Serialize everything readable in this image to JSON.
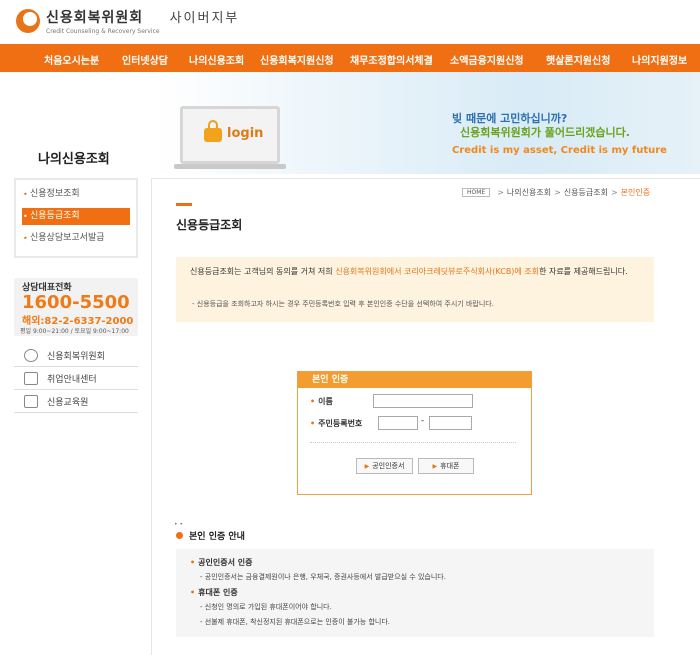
{
  "header": {
    "logo_title": "신용회복위원회",
    "logo_sub": "Credit Counseling & Recovery Service",
    "cyber": "사이버지부"
  },
  "gnb": [
    "처음오시는분",
    "인터넷상담",
    "나의신용조회",
    "신용회복지원신청",
    "채무조정합의서체결",
    "소액금융지원신청",
    "햇살론지원신청",
    "나의지원정보"
  ],
  "banner": {
    "page_heading": "나의신용조회",
    "login": "login",
    "slogan1": "빚 때문에 고민하십니까?",
    "slogan2": "신용회복위원회가 풀어드리겠습니다.",
    "slogan3": "Credit is my asset, Credit is my future"
  },
  "lnb": [
    "신용정보조회",
    "신용등급조회",
    "신용상담보고서발급"
  ],
  "phone": {
    "label": "상담대표전화",
    "number": "1600-5500",
    "abroad": "해외:82-2-6337-2000",
    "hours": "평일 9:00~21:00 / 토요일 9:00~17:00"
  },
  "quick_links": [
    "신용회복위원회",
    "취업안내센터",
    "신용교육원"
  ],
  "breadcrumb": {
    "home": "HOME",
    "level1": "나의신용조회",
    "level2": "신용등급조회",
    "current": "본인인증"
  },
  "title": "신용등급조회",
  "notice": {
    "p1": "신용등급조회는 고객님의 동의를 거쳐 저희 ",
    "p1_hl": "신용회복위원회에서 코리아크레딧뷰로주식회사(KCB)에 조회",
    "p1_end": "한 자료를 제공해드립니다.",
    "p2": "- 신용등급을 조회하고자 하시는 경우 주민등록번호 입력 후 본인인증 수단을 선택하여 주시기 바랍니다."
  },
  "auth": {
    "head": "본인 인증",
    "name_label": "이름",
    "rrn_label": "주민등록번호",
    "dash": "-",
    "btn_cert": "공인인증서",
    "btn_phone": "휴대폰"
  },
  "guide": {
    "dots": "• •",
    "title": "본인 인증 안내",
    "h1": "공인인증서 인증",
    "t1": "- 공인인증서는 금융결제원이나 은행, 우체국, 증권사등에서 발급받으실 수 있습니다.",
    "h2": "휴대폰 인증",
    "t2": "- 신청인 명의로 가입된 휴대폰이어야 합니다.",
    "t3": "- 선불제 휴대폰, 착신정지된 휴대폰으로는 인증이 불가능 합니다."
  },
  "colors": {
    "accent": "#ef6f12",
    "notice_bg": "#fdf3df",
    "auth_head": "#f39c30"
  }
}
